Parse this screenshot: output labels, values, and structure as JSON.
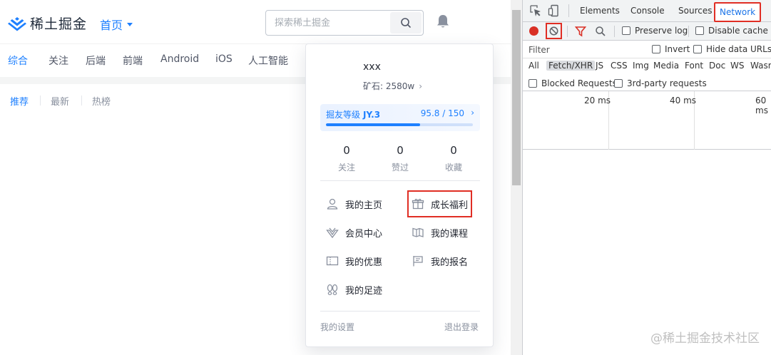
{
  "header": {
    "logo_text": "稀土掘金",
    "home_nav": "首页",
    "search_placeholder": "探索稀土掘金"
  },
  "categories": [
    "综合",
    "关注",
    "后端",
    "前端",
    "Android",
    "iOS",
    "人工智能"
  ],
  "sub_tabs": [
    "推荐",
    "最新",
    "热榜"
  ],
  "dropdown": {
    "username": "xxx",
    "ore": "矿石: 2580w",
    "level_label": "掘友等级",
    "level_value": "JY.3",
    "level_score": "95.8 / 150",
    "level_progress": 0.64,
    "stats": [
      {
        "num": "0",
        "label": "关注"
      },
      {
        "num": "0",
        "label": "赞过"
      },
      {
        "num": "0",
        "label": "收藏"
      }
    ],
    "menu": [
      {
        "label": "我的主页",
        "icon": "user-icon"
      },
      {
        "label": "成长福利",
        "icon": "gift-icon"
      },
      {
        "label": "会员中心",
        "icon": "vip-icon"
      },
      {
        "label": "我的课程",
        "icon": "book-icon"
      },
      {
        "label": "我的优惠",
        "icon": "coupon-icon"
      },
      {
        "label": "我的报名",
        "icon": "flag-icon"
      },
      {
        "label": "我的足迹",
        "icon": "footprint-icon"
      }
    ],
    "settings": "我的设置",
    "logout": "退出登录"
  },
  "devtools": {
    "tabs": [
      "Elements",
      "Console",
      "Sources",
      "Network"
    ],
    "active_tab": "Network",
    "preserve_log": "Preserve log",
    "disable_cache": "Disable cache",
    "filter_placeholder": "Filter",
    "invert": "Invert",
    "hide_data_urls": "Hide data URLs",
    "types": [
      "All",
      "Fetch/XHR",
      "JS",
      "CSS",
      "Img",
      "Media",
      "Font",
      "Doc",
      "WS",
      "Wasm"
    ],
    "active_type": "Fetch/XHR",
    "blocked_requests": "Blocked Requests",
    "third_party": "3rd-party requests",
    "timeline_ticks": [
      "20 ms",
      "40 ms",
      "60 ms"
    ]
  },
  "watermark": "@稀土掘金技术社区",
  "colors": {
    "brand_blue": "#1e80ff",
    "highlight_red": "#e02e24",
    "record_red": "#d93025"
  }
}
